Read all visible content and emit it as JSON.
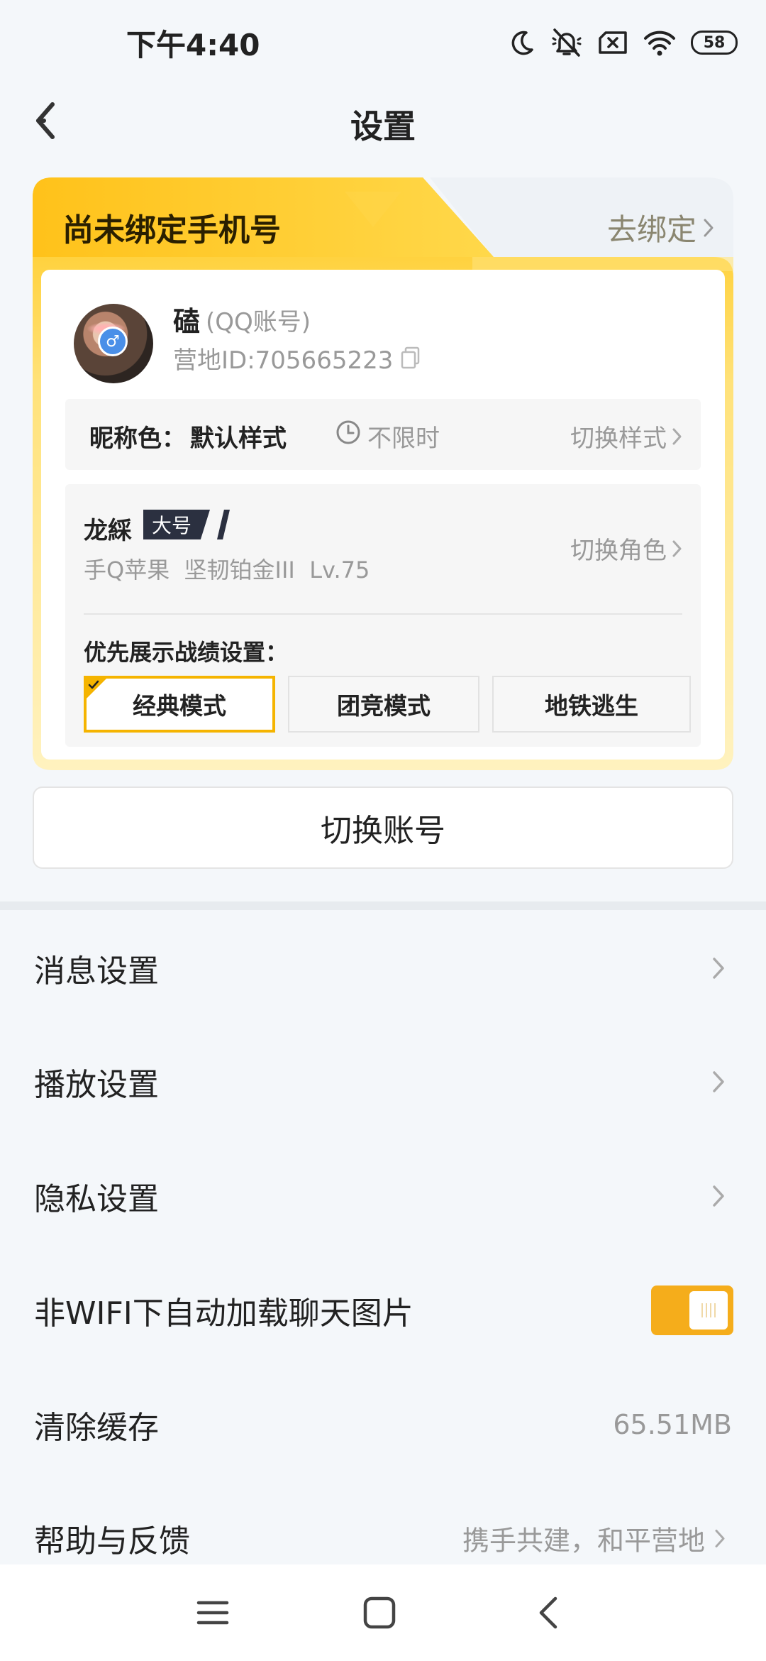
{
  "status_bar": {
    "time": "下午4:40",
    "battery": "58",
    "icons": [
      "moon-icon",
      "mute-icon",
      "no-sim-icon",
      "wifi-icon",
      "battery-icon"
    ]
  },
  "header": {
    "title": "设置",
    "back_icon": "back-arrow-icon"
  },
  "bind_phone": {
    "title": "尚未绑定手机号",
    "link": "去绑定"
  },
  "account": {
    "name": "磕",
    "type": "(QQ账号)",
    "camp_id": "营地ID:705665223",
    "gender_symbol": "♂",
    "nickname_color": {
      "label": "昵称色：",
      "value": "默认样式",
      "duration": "不限时",
      "switch_label": "切换样式"
    },
    "role": {
      "name": "龙綵",
      "tag": "大号",
      "meta": "手Q苹果  坚韧铂金III  Lv.75",
      "switch_label": "切换角色"
    },
    "preferred_stats": {
      "label": "优先展示战绩设置：",
      "modes": [
        "经典模式",
        "团竞模式",
        "地铁逃生"
      ],
      "selected": "经典模式"
    }
  },
  "switch_account": "切换账号",
  "settings": {
    "message": "消息设置",
    "playback": "播放设置",
    "privacy": "隐私设置",
    "auto_load": {
      "label": "非WIFI下自动加载聊天图片",
      "enabled": true
    },
    "cache": {
      "label": "清除缓存",
      "value": "65.51MB"
    },
    "help": {
      "label": "帮助与反馈",
      "value": "携手共建，和平营地"
    }
  },
  "nav_bar": [
    "menu-icon",
    "home-icon",
    "back-icon"
  ],
  "colors": {
    "accent": "#f5ad1b",
    "card_yellow": "#ffd233",
    "background": "#f4f7fa"
  }
}
